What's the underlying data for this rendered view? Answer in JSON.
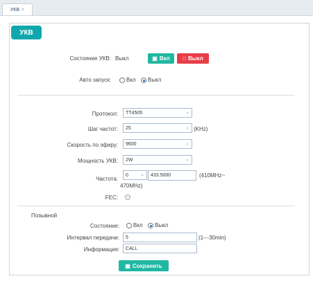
{
  "tab": {
    "label": "УКВ",
    "close": "×"
  },
  "panel": {
    "title": "УКВ"
  },
  "status": {
    "label": "Состояние УКВ:",
    "value": "Выкл",
    "on_button": "Вкл",
    "off_button": "Выкл"
  },
  "autostart": {
    "label": "Авто запуск:",
    "option_on": "Вкл",
    "option_off": "Выкл",
    "selected": "Выкл"
  },
  "settings": {
    "protocol_label": "Протокол:",
    "protocol_value": "TT4505",
    "step_label": "Шаг частот:",
    "step_value": "25",
    "step_unit": "(KHz)",
    "airspeed_label": "Скорость по эфиру:",
    "airspeed_value": "9600",
    "power_label": "Мощность УКВ:",
    "power_value": "2W",
    "freq_label": "Частота:",
    "freq_select": "0",
    "freq_value": "433.5000",
    "freq_range_a": "(410MHz~",
    "freq_range_b": "470MHz)",
    "fec_label": "FEC:"
  },
  "callsign": {
    "section_label": "Позывной",
    "state_label": "Состояние:",
    "option_on": "Вкл",
    "option_off": "Выкл",
    "selected": "Выкл",
    "interval_label": "Интервал передачи:",
    "interval_value": "5",
    "interval_hint": "(1---30min)",
    "info_label": "Информация:",
    "info_value": "CALL"
  },
  "save_button": "Сохранить",
  "colors": {
    "teal": "#11a8ad",
    "green": "#20b7a2",
    "red": "#e83c47"
  }
}
